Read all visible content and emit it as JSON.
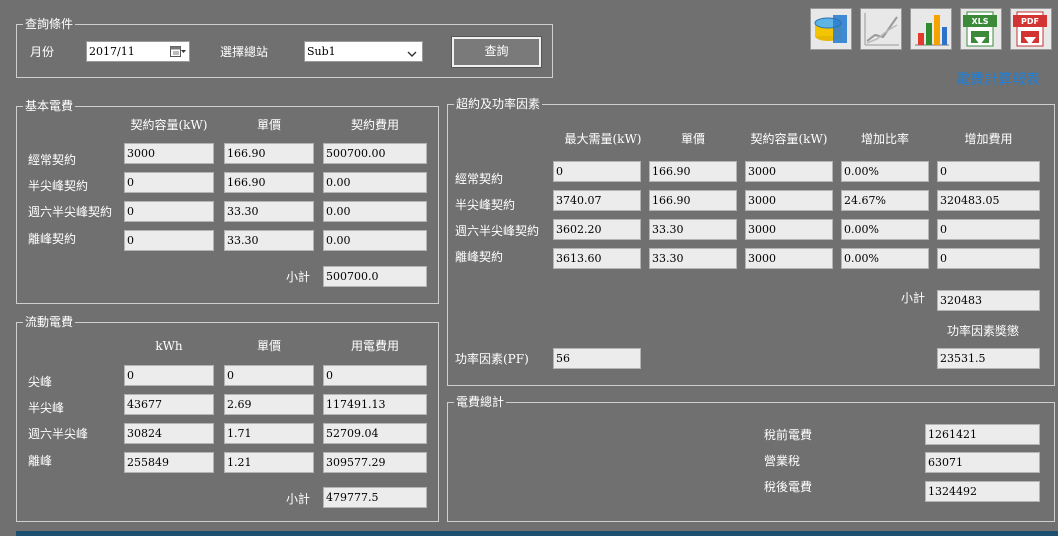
{
  "query": {
    "legend": "查詢條件",
    "month_label": "月份",
    "month_value": "2017/11",
    "station_label": "選擇總站",
    "station_value": "Sub1",
    "query_button": "查詢"
  },
  "report_title": "電費計算報表",
  "toolbar": {
    "icons": [
      "database-icon",
      "chart-line-icon",
      "bar-chart-icon",
      "export-xls-icon",
      "export-pdf-icon"
    ],
    "xls_text": "XLS",
    "pdf_text": "PDF"
  },
  "basic": {
    "legend": "基本電費",
    "headers": [
      "契約容量(kW)",
      "單價",
      "契約費用"
    ],
    "rows": [
      {
        "label": "經常契約",
        "capacity": "3000",
        "price": "166.90",
        "fee": "500700.00"
      },
      {
        "label": "半尖峰契約",
        "capacity": "0",
        "price": "166.90",
        "fee": "0.00"
      },
      {
        "label": "週六半尖峰契約",
        "capacity": "0",
        "price": "33.30",
        "fee": "0.00"
      },
      {
        "label": "離峰契約",
        "capacity": "0",
        "price": "33.30",
        "fee": "0.00"
      }
    ],
    "subtotal_label": "小計",
    "subtotal_value": "500700.0"
  },
  "flow": {
    "legend": "流動電費",
    "headers": [
      "kWh",
      "單價",
      "用電費用"
    ],
    "rows": [
      {
        "label": "尖峰",
        "kwh": "0",
        "price": "0",
        "fee": "0"
      },
      {
        "label": "半尖峰",
        "kwh": "43677",
        "price": "2.69",
        "fee": "117491.13"
      },
      {
        "label": "週六半尖峰",
        "kwh": "30824",
        "price": "1.71",
        "fee": "52709.04"
      },
      {
        "label": "離峰",
        "kwh": "255849",
        "price": "1.21",
        "fee": "309577.29"
      }
    ],
    "subtotal_label": "小計",
    "subtotal_value": "479777.5"
  },
  "over": {
    "legend": "超約及功率因素",
    "headers": [
      "最大需量(kW)",
      "單價",
      "契約容量(kW)",
      "增加比率",
      "增加費用"
    ],
    "rows": [
      {
        "label": "經常契約",
        "demand": "0",
        "price": "166.90",
        "capacity": "3000",
        "ratio": "0.00%",
        "fee": "0"
      },
      {
        "label": "半尖峰契約",
        "demand": "3740.07",
        "price": "166.90",
        "capacity": "3000",
        "ratio": "24.67%",
        "fee": "320483.05"
      },
      {
        "label": "週六半尖峰契約",
        "demand": "3602.20",
        "price": "33.30",
        "capacity": "3000",
        "ratio": "0.00%",
        "fee": "0"
      },
      {
        "label": "離峰契約",
        "demand": "3613.60",
        "price": "33.30",
        "capacity": "3000",
        "ratio": "0.00%",
        "fee": "0"
      }
    ],
    "subtotal_label": "小計",
    "subtotal_value": "320483",
    "pf_bonus_label": "功率因素獎懲",
    "pf_label": "功率因素(PF)",
    "pf_value": "56",
    "pf_bonus_value": "23531.5"
  },
  "total": {
    "legend": "電費總計",
    "pre_tax_label": "稅前電費",
    "pre_tax_value": "1261421",
    "tax_label": "營業稅",
    "tax_value": "63071",
    "post_tax_label": "稅後電費",
    "post_tax_value": "1324492"
  }
}
